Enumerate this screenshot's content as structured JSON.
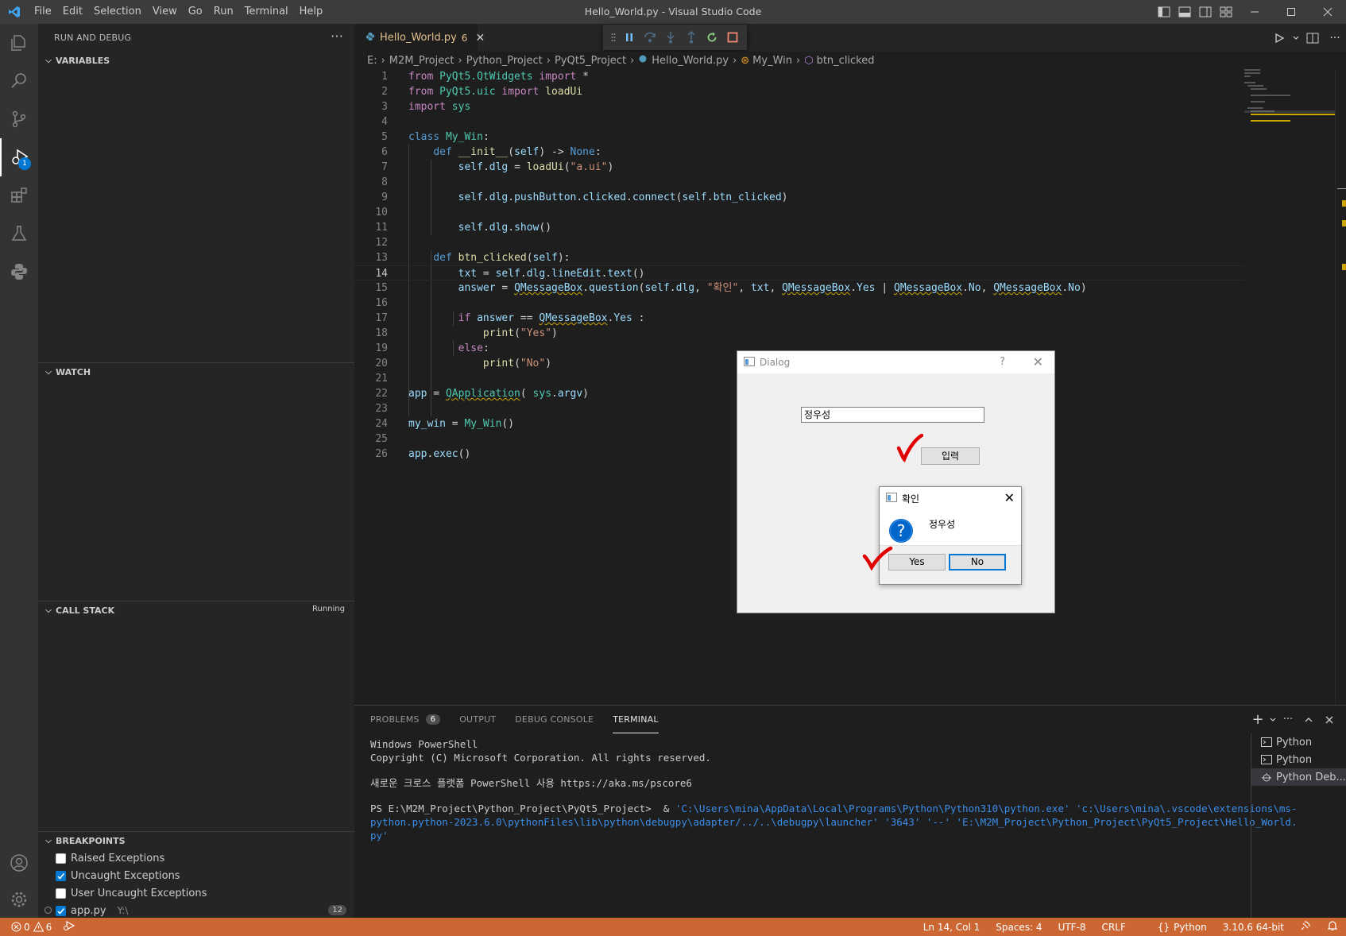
{
  "titlebar": {
    "title": "Hello_World.py - Visual Studio Code",
    "menu": [
      "File",
      "Edit",
      "Selection",
      "View",
      "Go",
      "Run",
      "Terminal",
      "Help"
    ]
  },
  "activitybar": {
    "debug_badge": "1"
  },
  "sidebar": {
    "header": "RUN AND DEBUG",
    "variables": "VARIABLES",
    "watch": "WATCH",
    "call_stack": "CALL STACK",
    "call_stack_status": "Running",
    "breakpoints": "BREAKPOINTS",
    "bp_items": [
      {
        "label": "Raised Exceptions",
        "checked": false
      },
      {
        "label": "Uncaught Exceptions",
        "checked": true
      },
      {
        "label": "User Uncaught Exceptions",
        "checked": false
      }
    ],
    "bp_file": {
      "label": "app.py",
      "path": "Y:\\",
      "count": "12"
    }
  },
  "editor": {
    "tab_name": "Hello_World.py",
    "tab_problems": "6",
    "breadcrumb": [
      "E:",
      "M2M_Project",
      "Python_Project",
      "PyQt5_Project",
      "Hello_World.py",
      "My_Win",
      "btn_clicked"
    ]
  },
  "panel": {
    "tabs": [
      "PROBLEMS",
      "OUTPUT",
      "DEBUG CONSOLE",
      "TERMINAL"
    ],
    "problems_count": "6",
    "terminal_lines": [
      "Windows PowerShell",
      "Copyright (C) Microsoft Corporation. All rights reserved.",
      "",
      "새로운 크로스 플랫폼 PowerShell 사용 https://aka.ms/pscore6",
      ""
    ],
    "prompt": "PS E:\\M2M_Project\\Python_Project\\PyQt5_Project>  & ",
    "command_1": "'C:\\Users\\mina\\AppData\\Local\\Programs\\Python\\Python310\\python.exe' 'c:\\Users\\mina\\.vscode\\extensions\\ms-",
    "command_2": "python.python-2023.6.0\\pythonFiles\\lib\\python\\debugpy\\adapter/../..\\debugpy\\launcher' '3643' '--' 'E:\\M2M_Project\\Python_Project\\PyQt5_Project\\Hello_World.",
    "command_3": "py'",
    "terminals": [
      "Python",
      "Python",
      "Python Deb..."
    ]
  },
  "statusbar": {
    "errors": "0",
    "warnings": "6",
    "position": "Ln 14, Col 1",
    "spaces": "Spaces: 4",
    "encoding": "UTF-8",
    "eol": "CRLF",
    "language": "Python",
    "interpreter": "3.10.6 64-bit",
    "background": "#cc6633"
  },
  "qt_dialog": {
    "title": "Dialog",
    "help": "?",
    "line_edit": "정우성",
    "button": "입력"
  },
  "message_box": {
    "title": "확인",
    "text": "정우성",
    "yes": "Yes",
    "no": "No"
  }
}
